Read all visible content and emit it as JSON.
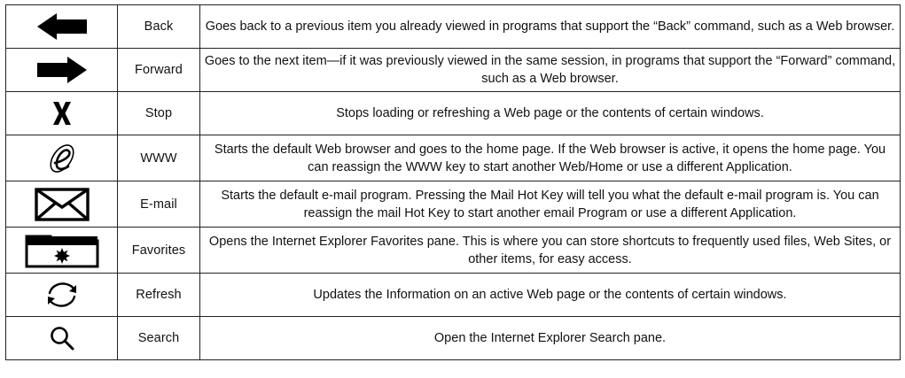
{
  "hotkeys": [
    {
      "icon": "back-arrow-icon",
      "name": "Back",
      "description": "Goes back to a previous item you already viewed in programs that support the “Back” command, such as a Web browser."
    },
    {
      "icon": "forward-arrow-icon",
      "name": "Forward",
      "description": "Goes to the next item—if it was previously viewed in the same session, in programs that support the “Forward” command, such as a Web browser."
    },
    {
      "icon": "stop-x-icon",
      "name": "Stop",
      "description": "Stops loading or refreshing a Web page or the contents of certain windows."
    },
    {
      "icon": "internet-explorer-e-icon",
      "name": "WWW",
      "description": "Starts the default Web browser and goes to the home page. If the Web browser is active, it opens the home page. You can reassign the WWW key to start another Web/Home or use a different Application."
    },
    {
      "icon": "envelope-icon",
      "name": "E-mail",
      "description": "Starts the default e-mail program. Pressing the Mail Hot Key will tell you what the default e-mail program is. You can reassign the mail Hot Key to start another email Program or use a different Application."
    },
    {
      "icon": "favorites-folder-icon",
      "name": "Favorites",
      "description": "Opens the Internet Explorer Favorites pane. This is where you can store shortcuts to frequently used files, Web Sites, or other items, for easy access."
    },
    {
      "icon": "refresh-arrows-icon",
      "name": "Refresh",
      "description": "Updates the Information on an active Web page or the contents of certain windows."
    },
    {
      "icon": "magnifier-search-icon",
      "name": "Search",
      "description": "Open the Internet Explorer Search pane."
    }
  ]
}
